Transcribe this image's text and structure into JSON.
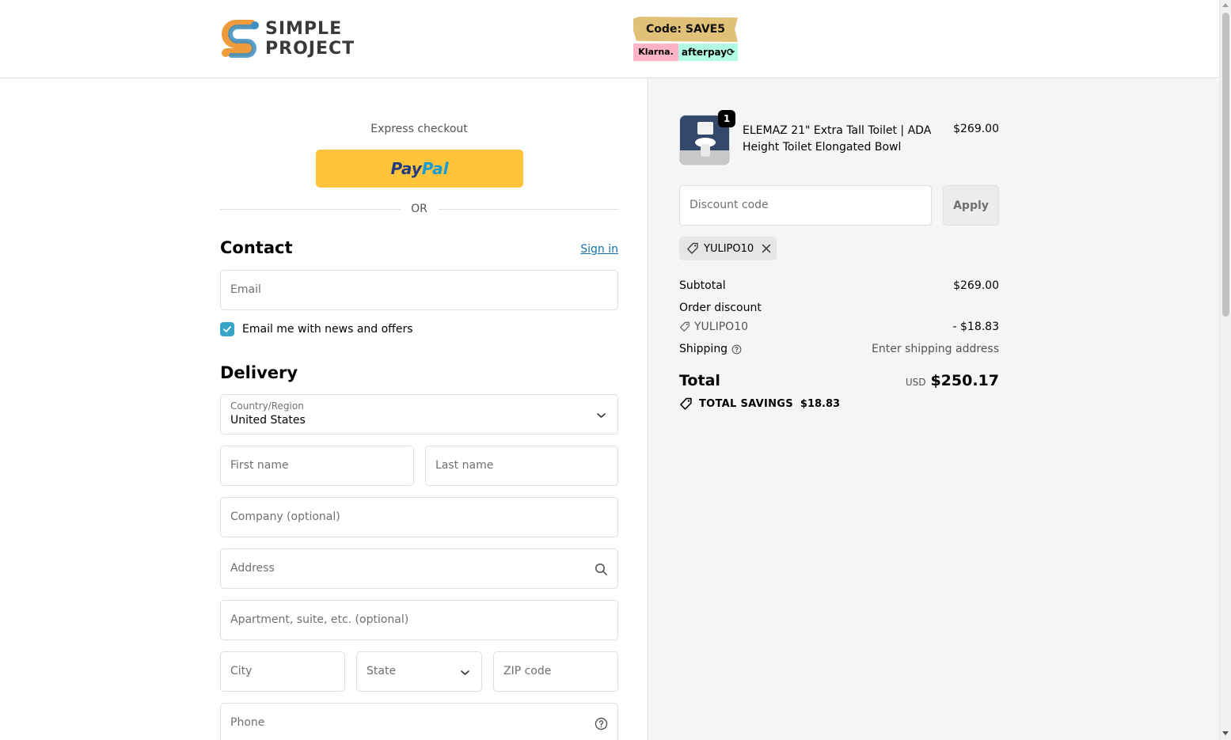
{
  "header": {
    "logo_line1": "SIMPLE",
    "logo_line2": "PROJECT",
    "promo_code": "Code: SAVE5",
    "promo_klarna": "Klarna.",
    "promo_afterpay": "afterpay⟳"
  },
  "express": {
    "label": "Express checkout",
    "paypal_part1": "Pay",
    "paypal_part2": "Pal",
    "or_text": "OR"
  },
  "contact": {
    "title": "Contact",
    "signin_label": "Sign in",
    "email_placeholder": "Email",
    "newsletter_label": "Email me with news and offers",
    "newsletter_checked": true
  },
  "delivery": {
    "title": "Delivery",
    "country_label": "Country/Region",
    "country_value": "United States",
    "first_name_placeholder": "First name",
    "last_name_placeholder": "Last name",
    "company_placeholder": "Company (optional)",
    "address_placeholder": "Address",
    "apartment_placeholder": "Apartment, suite, etc. (optional)",
    "city_placeholder": "City",
    "state_placeholder": "State",
    "zip_placeholder": "ZIP code",
    "phone_placeholder": "Phone"
  },
  "summary": {
    "item": {
      "quantity": "1",
      "name": "ELEMAZ 21\" Extra Tall Toilet | ADA Height Toilet Elongated Bowl",
      "price": "$269.00"
    },
    "discount_placeholder": "Discount code",
    "apply_label": "Apply",
    "applied_code": "YULIPO10",
    "subtotal_label": "Subtotal",
    "subtotal_value": "$269.00",
    "order_discount_label": "Order discount",
    "discount_code_label": "YULIPO10",
    "discount_value": "- $18.83",
    "shipping_label": "Shipping",
    "shipping_value": "Enter shipping address",
    "total_label": "Total",
    "total_currency": "USD",
    "total_value": "$250.17",
    "savings_label": "TOTAL SAVINGS",
    "savings_value": "$18.83"
  },
  "colors": {
    "accent": "#35a4c6",
    "link": "#1773b0",
    "paypal_yellow": "#ffc439",
    "summary_bg": "#f5f5f5"
  }
}
